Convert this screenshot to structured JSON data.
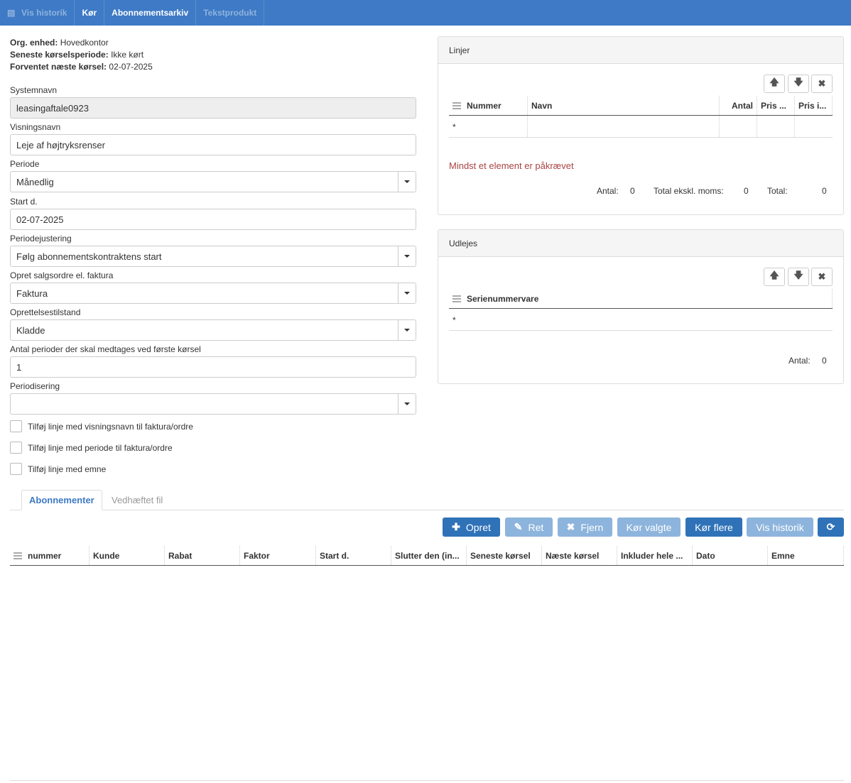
{
  "toolbar": {
    "vis_historik": "Vis historik",
    "koer": "Kør",
    "abonnementsarkiv": "Abonnementsarkiv",
    "tekstprodukt": "Tekstprodukt"
  },
  "info": {
    "org_label": "Org. enhed:",
    "org_value": "Hovedkontor",
    "last_label": "Seneste kørselsperiode:",
    "last_value": "Ikke kørt",
    "next_label": "Forventet næste kørsel:",
    "next_value": "02-07-2025"
  },
  "form": {
    "systemnavn_label": "Systemnavn",
    "systemnavn_value": "leasingaftale0923",
    "visningsnavn_label": "Visningsnavn",
    "visningsnavn_value": "Leje af højtryksrenser",
    "periode_label": "Periode",
    "periode_value": "Månedlig",
    "start_label": "Start d.",
    "start_value": "02-07-2025",
    "periodejustering_label": "Periodejustering",
    "periodejustering_value": "Følg abonnementskontraktens start",
    "opret_label": "Opret salgsordre el. faktura",
    "opret_value": "Faktura",
    "tilstand_label": "Oprettelsestilstand",
    "tilstand_value": "Kladde",
    "antal_label": "Antal perioder der skal medtages ved første kørsel",
    "antal_value": "1",
    "periodisering_label": "Periodisering",
    "periodisering_value": "",
    "cb1": "Tilføj linje med visningsnavn til faktura/ordre",
    "cb2": "Tilføj linje med periode til faktura/ordre",
    "cb3": "Tilføj linje med emne"
  },
  "linjer": {
    "title": "Linjer",
    "columns": [
      "Nummer",
      "Navn",
      "Antal",
      "Pris ...",
      "Pris i..."
    ],
    "new_row_marker": "*",
    "error": "Mindst et element er påkrævet",
    "antal_label": "Antal:",
    "antal_value": "0",
    "total_excl_label": "Total ekskl. moms:",
    "total_excl_value": "0",
    "total_label": "Total:",
    "total_value": "0"
  },
  "udlejes": {
    "title": "Udlejes",
    "columns": [
      "Serienummervare"
    ],
    "new_row_marker": "*",
    "antal_label": "Antal:",
    "antal_value": "0"
  },
  "tabs": {
    "abonnementer": "Abonnementer",
    "vedhaeftet": "Vedhæftet fil"
  },
  "actions": {
    "opret": "Opret",
    "ret": "Ret",
    "fjern": "Fjern",
    "koer_valgte": "Kør valgte",
    "koer_flere": "Kør flere",
    "vis_historik": "Vis historik"
  },
  "subs_grid": {
    "columns": [
      "nummer",
      "Kunde",
      "Rabat",
      "Faktor",
      "Start d.",
      "Slutter den (in...",
      "Seneste kørsel",
      "Næste kørsel",
      "Inkluder hele ...",
      "Dato",
      "Emne"
    ]
  },
  "colors": {
    "toolbar": "#3e7ac5",
    "primary": "#2f72b8",
    "faded": "#8db4dc",
    "error": "#a94442"
  }
}
